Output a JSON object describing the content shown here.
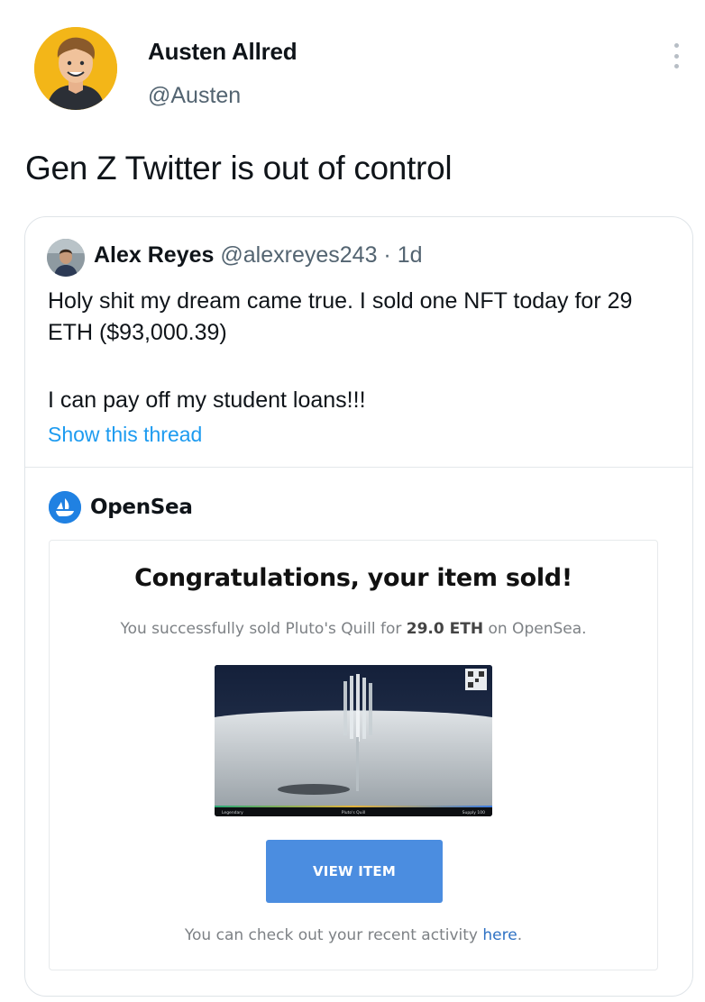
{
  "author": {
    "name": "Austen Allred",
    "handle": "@Austen",
    "avatar_icon": "avatar-portrait-icon"
  },
  "tweet": {
    "text": "Gen Z Twitter is out of control"
  },
  "more_icon": "more-vertical-icon",
  "quoted_tweet": {
    "name": "Alex Reyes",
    "handle": "@alexreyes243",
    "separator": " · ",
    "time": "1d",
    "line1": "Holy shit my dream came true. I sold one NFT today for 29 ETH ($93,000.39)",
    "line2": "I can pay off my student loans!!!",
    "show_thread": "Show this thread"
  },
  "opensea": {
    "name": "OpenSea",
    "logo_icon": "opensea-logo-icon"
  },
  "email": {
    "title": "Congratulations, your item sold!",
    "sub_prefix": "You successfully sold Pluto's Quill for ",
    "sub_amount": "29.0 ETH",
    "sub_suffix": " on OpenSea.",
    "button_label": "VIEW ITEM",
    "foot_prefix": "You can check out your recent activity ",
    "foot_link": "here",
    "foot_suffix": "."
  },
  "nft": {
    "label_left": "Legendary",
    "label_center": "Pluto's Quill",
    "label_right": "Supply 100"
  },
  "colors": {
    "link": "#1d9bf0",
    "opensea_blue": "#2081e2",
    "button_blue": "#4b8de0",
    "avatar_yellow": "#f3b618"
  }
}
